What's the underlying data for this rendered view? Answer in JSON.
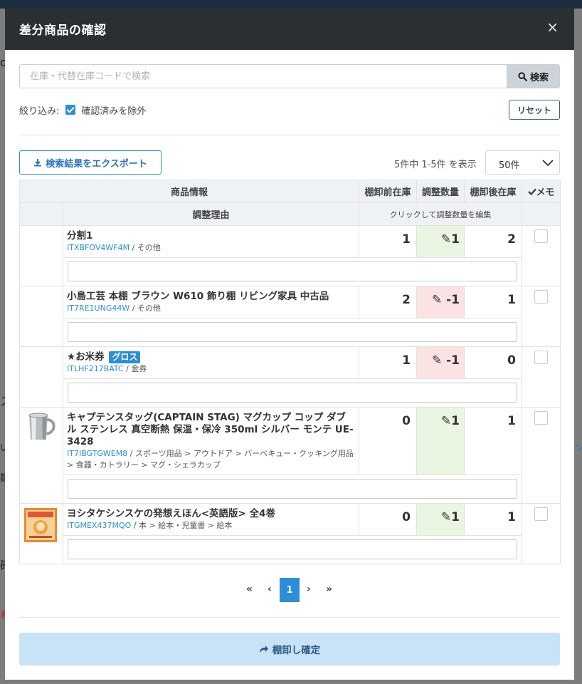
{
  "modal": {
    "title": "差分商品の確認",
    "close": "×"
  },
  "search": {
    "placeholder": "在庫・代替在庫コードで検索",
    "button": "検索"
  },
  "filter": {
    "label": "絞り込み:",
    "option": "確認済みを除外",
    "checked": true,
    "reset": "リセット"
  },
  "toolbar": {
    "export": "検索結果をエクスポート",
    "count": "5件中 1-5件 を表示",
    "per_page": "50件"
  },
  "table": {
    "headers": {
      "product": "商品情報",
      "before": "棚卸前在庫",
      "adjust": "調整数量",
      "after": "棚卸後在庫",
      "memo": "メモ",
      "reason": "調整理由",
      "adjust_hint": "クリックして調整数量を編集"
    },
    "rows": [
      {
        "name": "分割1",
        "code": "ITXBFOV4WF4M",
        "category": " / その他",
        "badge": "",
        "image": "",
        "before": "1",
        "adjust": "1",
        "after": "2",
        "reason": ""
      },
      {
        "name": "小島工芸 本棚 ブラウン W610 飾り棚 リビング家具 中古品",
        "code": "IT7RE1UNG44W",
        "category": " / その他",
        "badge": "",
        "image": "",
        "before": "2",
        "adjust": "-1",
        "after": "1",
        "reason": ""
      },
      {
        "name": "★お米券",
        "code": "ITLHF217BATC",
        "category": " / 金券",
        "badge": "グロス",
        "image": "",
        "before": "1",
        "adjust": "-1",
        "after": "0",
        "reason": ""
      },
      {
        "name": "キャプテンスタッグ(CAPTAIN STAG) マグカップ コップ ダブル ステンレス 真空断熱 保温・保冷 350ml シルバー モンテ UE-3428",
        "code": "IT7IBGTGWEM8",
        "category": " / スポーツ用品 > アウトドア > バーベキュー・クッキング用品 > 食器・カトラリー > マグ・シェラカップ",
        "badge": "",
        "image": "steel-mug",
        "before": "0",
        "adjust": "1",
        "after": "1",
        "reason": ""
      },
      {
        "name": "ヨシタケシンスケの発想えほん<英語版> 全4巻",
        "code": "ITGMEX437MQO",
        "category": " / 本 > 絵本・児童書 > 絵本",
        "badge": "",
        "image": "picture-book",
        "before": "0",
        "adjust": "1",
        "after": "1",
        "reason": ""
      }
    ]
  },
  "pagination": {
    "first": "«",
    "prev": "‹",
    "current": "1",
    "next": "›",
    "last": "»"
  },
  "confirm": {
    "label": "棚卸し確定"
  },
  "colors": {
    "primary": "#2b8ed6",
    "positive_bg": "#eaf5e2",
    "negative_bg": "#fbe3e3",
    "header_bg": "#2b2f34"
  },
  "background": {
    "fragments": [
      "o",
      "ス",
      "い",
      "鄒",
      "確",
      "着",
      "シ"
    ]
  }
}
